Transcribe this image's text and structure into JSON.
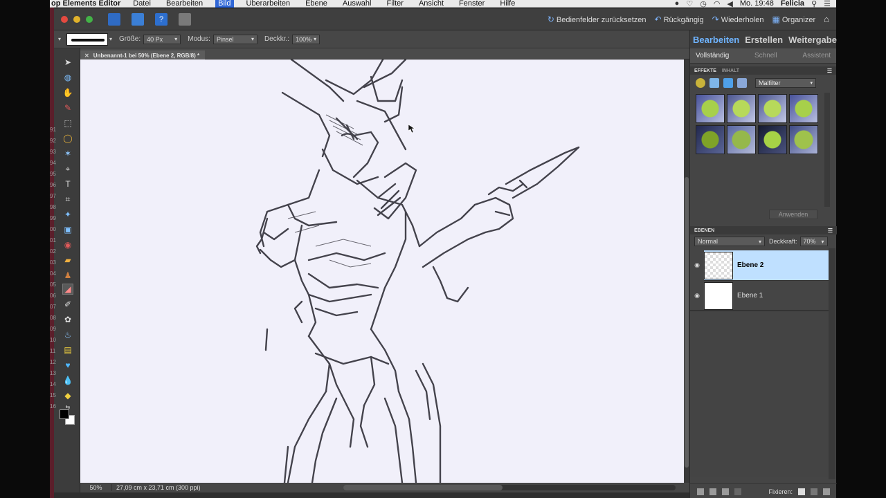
{
  "menubar": {
    "app": "op Elements Editor",
    "items": [
      "Datei",
      "Bearbeiten",
      "Bild",
      "Überarbeiten",
      "Ebene",
      "Auswahl",
      "Filter",
      "Ansicht",
      "Fenster",
      "Hilfe"
    ],
    "active_item": "Bild",
    "clock": "Mo. 19:48",
    "user": "Felicia"
  },
  "titlebar": {
    "reset_panels": "Bedienfelder zurücksetzen",
    "undo": "Rückgängig",
    "redo": "Wiederholen",
    "organizer": "Organizer"
  },
  "options": {
    "size_label": "Größe:",
    "size_value": "40 Px",
    "mode_label": "Modus:",
    "mode_value": "Pinsel",
    "opacity_label": "Deckkr.:",
    "opacity_value": "100%"
  },
  "document": {
    "tab_title": "Unbenannt-1 bei 50% (Ebene 2, RGB/8) *"
  },
  "toolbox": {
    "ruler_numbers": [
      "91",
      "92",
      "93",
      "94",
      "95",
      "96",
      "97",
      "98",
      "99",
      "00",
      "01",
      "02",
      "03",
      "04",
      "05",
      "06",
      "07",
      "08",
      "09",
      "10",
      "11",
      "12",
      "13",
      "14",
      "15",
      "16"
    ]
  },
  "status": {
    "zoom": "50%",
    "doc_info": "27,09 cm x 23,71 cm (300 ppi)"
  },
  "panel": {
    "mode_tabs": [
      "Bearbeiten",
      "Erstellen",
      "Weitergabe"
    ],
    "sub_tabs": [
      "Vollständig",
      "Schnell",
      "Assistent"
    ],
    "effects_head": "EFFEKTE",
    "content_head": "INHALT",
    "filter_dropdown": "Malfilter",
    "apply_button": "Anwenden",
    "layers_head": "EBENEN",
    "blend_mode": "Normal",
    "opacity_label": "Deckkraft:",
    "opacity_value": "70%",
    "layers": [
      {
        "name": "Ebene 2",
        "active": true
      },
      {
        "name": "Ebene 1",
        "active": false
      }
    ],
    "fix_label": "Fixieren:"
  },
  "colors": {
    "accent_blue": "#6fb4ff",
    "selection_blue": "#bfe0ff",
    "canvas": "#f1f0fa",
    "sketch_stroke": "#44434c"
  }
}
